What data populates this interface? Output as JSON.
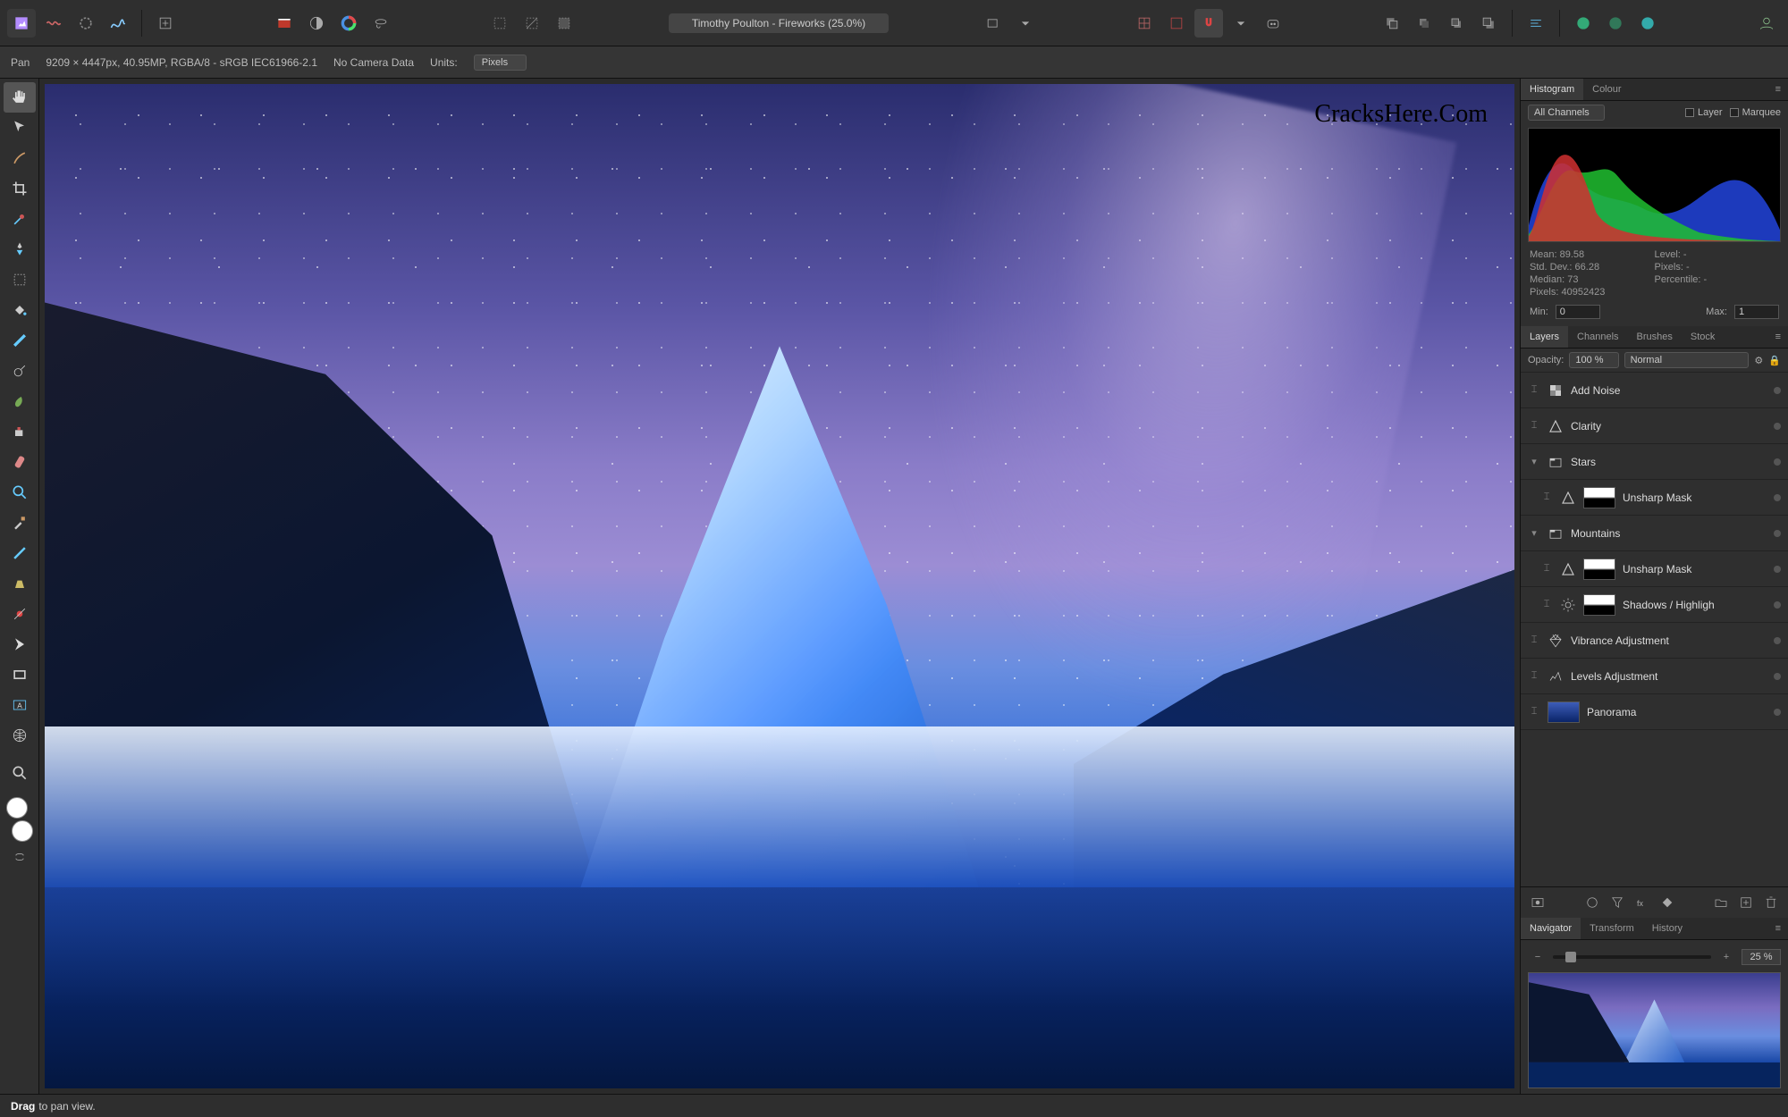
{
  "titlebar": {
    "doc_title": "Timothy Poulton - Fireworks (25.0%)"
  },
  "contextbar": {
    "tool_name": "Pan",
    "doc_info": "9209 × 4447px, 40.95MP, RGBA/8 - sRGB IEC61966-2.1",
    "camera": "No Camera Data",
    "units_label": "Units:",
    "units_value": "Pixels"
  },
  "watermark": "CracksHere.Com",
  "histogram": {
    "tabs": [
      "Histogram",
      "Colour"
    ],
    "channel": "All Channels",
    "layer_label": "Layer",
    "marquee_label": "Marquee",
    "stats": {
      "mean_label": "Mean:",
      "mean": "89.58",
      "std_label": "Std. Dev.:",
      "std": "66.28",
      "median_label": "Median:",
      "median": "73",
      "pixels_label": "Pixels:",
      "pixels": "40952423",
      "level_label": "Level:",
      "level": "-",
      "pixels2_label": "Pixels:",
      "pixels2": "-",
      "percentile_label": "Percentile:",
      "percentile": "-"
    },
    "min_label": "Min:",
    "min": "0",
    "max_label": "Max:",
    "max": "1"
  },
  "layers_panel": {
    "tabs": [
      "Layers",
      "Channels",
      "Brushes",
      "Stock"
    ],
    "opacity_label": "Opacity:",
    "opacity": "100 %",
    "blend": "Normal",
    "items": [
      {
        "name": "Add Noise",
        "kind": "checker",
        "child": false
      },
      {
        "name": "Clarity",
        "kind": "triangle",
        "child": false
      },
      {
        "name": "Stars",
        "kind": "group",
        "child": false,
        "expand": true
      },
      {
        "name": "Unsharp Mask",
        "kind": "triangle",
        "child": true,
        "thumb": true
      },
      {
        "name": "Mountains",
        "kind": "group",
        "child": false,
        "expand": true
      },
      {
        "name": "Unsharp Mask",
        "kind": "triangle",
        "child": true,
        "thumb": true
      },
      {
        "name": "Shadows / Highligh",
        "kind": "sun",
        "child": true,
        "thumb": true
      },
      {
        "name": "Vibrance Adjustment",
        "kind": "diamond",
        "child": false
      },
      {
        "name": "Levels Adjustment",
        "kind": "levels",
        "child": false
      },
      {
        "name": "Panorama",
        "kind": "photo",
        "child": false
      }
    ]
  },
  "navigator": {
    "tabs": [
      "Navigator",
      "Transform",
      "History"
    ],
    "zoom": "25 %"
  },
  "statusbar": {
    "bold": "Drag",
    "rest": "to pan view."
  }
}
